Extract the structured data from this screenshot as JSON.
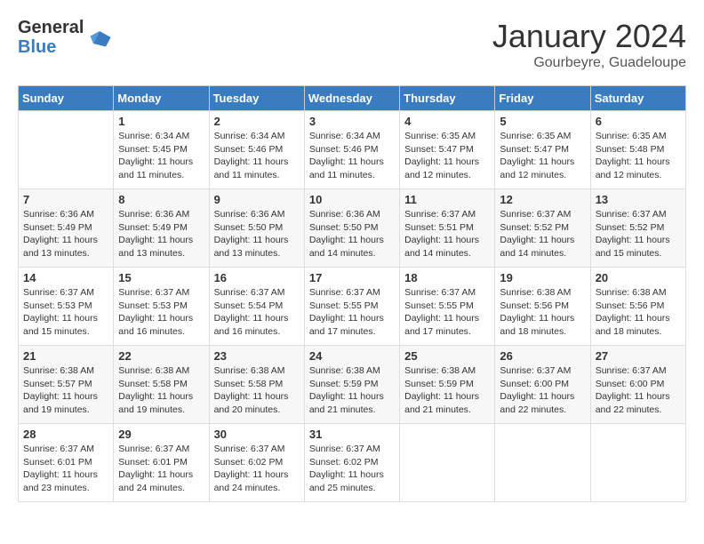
{
  "logo": {
    "general": "General",
    "blue": "Blue"
  },
  "title": "January 2024",
  "subtitle": "Gourbeyre, Guadeloupe",
  "headers": [
    "Sunday",
    "Monday",
    "Tuesday",
    "Wednesday",
    "Thursday",
    "Friday",
    "Saturday"
  ],
  "weeks": [
    [
      {
        "day": "",
        "sunrise": "",
        "sunset": "",
        "daylight": ""
      },
      {
        "day": "1",
        "sunrise": "Sunrise: 6:34 AM",
        "sunset": "Sunset: 5:45 PM",
        "daylight": "Daylight: 11 hours and 11 minutes."
      },
      {
        "day": "2",
        "sunrise": "Sunrise: 6:34 AM",
        "sunset": "Sunset: 5:46 PM",
        "daylight": "Daylight: 11 hours and 11 minutes."
      },
      {
        "day": "3",
        "sunrise": "Sunrise: 6:34 AM",
        "sunset": "Sunset: 5:46 PM",
        "daylight": "Daylight: 11 hours and 11 minutes."
      },
      {
        "day": "4",
        "sunrise": "Sunrise: 6:35 AM",
        "sunset": "Sunset: 5:47 PM",
        "daylight": "Daylight: 11 hours and 12 minutes."
      },
      {
        "day": "5",
        "sunrise": "Sunrise: 6:35 AM",
        "sunset": "Sunset: 5:47 PM",
        "daylight": "Daylight: 11 hours and 12 minutes."
      },
      {
        "day": "6",
        "sunrise": "Sunrise: 6:35 AM",
        "sunset": "Sunset: 5:48 PM",
        "daylight": "Daylight: 11 hours and 12 minutes."
      }
    ],
    [
      {
        "day": "7",
        "sunrise": "Sunrise: 6:36 AM",
        "sunset": "Sunset: 5:49 PM",
        "daylight": "Daylight: 11 hours and 13 minutes."
      },
      {
        "day": "8",
        "sunrise": "Sunrise: 6:36 AM",
        "sunset": "Sunset: 5:49 PM",
        "daylight": "Daylight: 11 hours and 13 minutes."
      },
      {
        "day": "9",
        "sunrise": "Sunrise: 6:36 AM",
        "sunset": "Sunset: 5:50 PM",
        "daylight": "Daylight: 11 hours and 13 minutes."
      },
      {
        "day": "10",
        "sunrise": "Sunrise: 6:36 AM",
        "sunset": "Sunset: 5:50 PM",
        "daylight": "Daylight: 11 hours and 14 minutes."
      },
      {
        "day": "11",
        "sunrise": "Sunrise: 6:37 AM",
        "sunset": "Sunset: 5:51 PM",
        "daylight": "Daylight: 11 hours and 14 minutes."
      },
      {
        "day": "12",
        "sunrise": "Sunrise: 6:37 AM",
        "sunset": "Sunset: 5:52 PM",
        "daylight": "Daylight: 11 hours and 14 minutes."
      },
      {
        "day": "13",
        "sunrise": "Sunrise: 6:37 AM",
        "sunset": "Sunset: 5:52 PM",
        "daylight": "Daylight: 11 hours and 15 minutes."
      }
    ],
    [
      {
        "day": "14",
        "sunrise": "Sunrise: 6:37 AM",
        "sunset": "Sunset: 5:53 PM",
        "daylight": "Daylight: 11 hours and 15 minutes."
      },
      {
        "day": "15",
        "sunrise": "Sunrise: 6:37 AM",
        "sunset": "Sunset: 5:53 PM",
        "daylight": "Daylight: 11 hours and 16 minutes."
      },
      {
        "day": "16",
        "sunrise": "Sunrise: 6:37 AM",
        "sunset": "Sunset: 5:54 PM",
        "daylight": "Daylight: 11 hours and 16 minutes."
      },
      {
        "day": "17",
        "sunrise": "Sunrise: 6:37 AM",
        "sunset": "Sunset: 5:55 PM",
        "daylight": "Daylight: 11 hours and 17 minutes."
      },
      {
        "day": "18",
        "sunrise": "Sunrise: 6:37 AM",
        "sunset": "Sunset: 5:55 PM",
        "daylight": "Daylight: 11 hours and 17 minutes."
      },
      {
        "day": "19",
        "sunrise": "Sunrise: 6:38 AM",
        "sunset": "Sunset: 5:56 PM",
        "daylight": "Daylight: 11 hours and 18 minutes."
      },
      {
        "day": "20",
        "sunrise": "Sunrise: 6:38 AM",
        "sunset": "Sunset: 5:56 PM",
        "daylight": "Daylight: 11 hours and 18 minutes."
      }
    ],
    [
      {
        "day": "21",
        "sunrise": "Sunrise: 6:38 AM",
        "sunset": "Sunset: 5:57 PM",
        "daylight": "Daylight: 11 hours and 19 minutes."
      },
      {
        "day": "22",
        "sunrise": "Sunrise: 6:38 AM",
        "sunset": "Sunset: 5:58 PM",
        "daylight": "Daylight: 11 hours and 19 minutes."
      },
      {
        "day": "23",
        "sunrise": "Sunrise: 6:38 AM",
        "sunset": "Sunset: 5:58 PM",
        "daylight": "Daylight: 11 hours and 20 minutes."
      },
      {
        "day": "24",
        "sunrise": "Sunrise: 6:38 AM",
        "sunset": "Sunset: 5:59 PM",
        "daylight": "Daylight: 11 hours and 21 minutes."
      },
      {
        "day": "25",
        "sunrise": "Sunrise: 6:38 AM",
        "sunset": "Sunset: 5:59 PM",
        "daylight": "Daylight: 11 hours and 21 minutes."
      },
      {
        "day": "26",
        "sunrise": "Sunrise: 6:37 AM",
        "sunset": "Sunset: 6:00 PM",
        "daylight": "Daylight: 11 hours and 22 minutes."
      },
      {
        "day": "27",
        "sunrise": "Sunrise: 6:37 AM",
        "sunset": "Sunset: 6:00 PM",
        "daylight": "Daylight: 11 hours and 22 minutes."
      }
    ],
    [
      {
        "day": "28",
        "sunrise": "Sunrise: 6:37 AM",
        "sunset": "Sunset: 6:01 PM",
        "daylight": "Daylight: 11 hours and 23 minutes."
      },
      {
        "day": "29",
        "sunrise": "Sunrise: 6:37 AM",
        "sunset": "Sunset: 6:01 PM",
        "daylight": "Daylight: 11 hours and 24 minutes."
      },
      {
        "day": "30",
        "sunrise": "Sunrise: 6:37 AM",
        "sunset": "Sunset: 6:02 PM",
        "daylight": "Daylight: 11 hours and 24 minutes."
      },
      {
        "day": "31",
        "sunrise": "Sunrise: 6:37 AM",
        "sunset": "Sunset: 6:02 PM",
        "daylight": "Daylight: 11 hours and 25 minutes."
      },
      {
        "day": "",
        "sunrise": "",
        "sunset": "",
        "daylight": ""
      },
      {
        "day": "",
        "sunrise": "",
        "sunset": "",
        "daylight": ""
      },
      {
        "day": "",
        "sunrise": "",
        "sunset": "",
        "daylight": ""
      }
    ]
  ]
}
